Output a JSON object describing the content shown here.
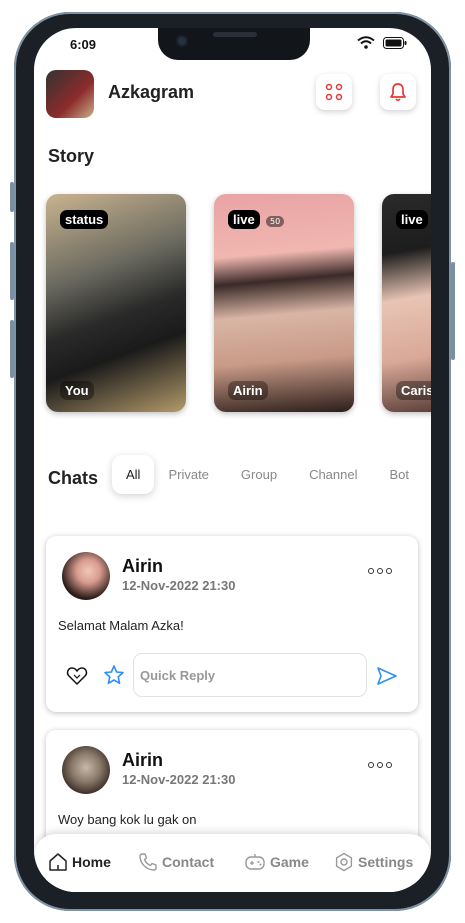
{
  "status_bar": {
    "time": "6:09"
  },
  "header": {
    "title": "Azkagram"
  },
  "story": {
    "title": "Story",
    "items": [
      {
        "badge": "status",
        "name": "You"
      },
      {
        "badge": "live",
        "count": "50",
        "name": "Airin"
      },
      {
        "badge": "live",
        "name": "Caris"
      }
    ]
  },
  "chats": {
    "title": "Chats",
    "tabs": [
      "All",
      "Private",
      "Group",
      "Channel",
      "Bot"
    ],
    "active_tab": "All",
    "quick_reply_placeholder": "Quick Reply",
    "items": [
      {
        "name": "Airin",
        "time": "12-Nov-2022 21:30",
        "message": "Selamat Malam Azka!"
      },
      {
        "name": "Airin",
        "time": "12-Nov-2022 21:30",
        "message": "Woy bang kok lu gak on"
      }
    ]
  },
  "bottom_nav": {
    "items": [
      "Home",
      "Contact",
      "Game",
      "Settings"
    ],
    "active": "Home"
  },
  "colors": {
    "accent": "#e53935",
    "blue_icon": "#2f8ff3",
    "frame": "#1b2027"
  }
}
